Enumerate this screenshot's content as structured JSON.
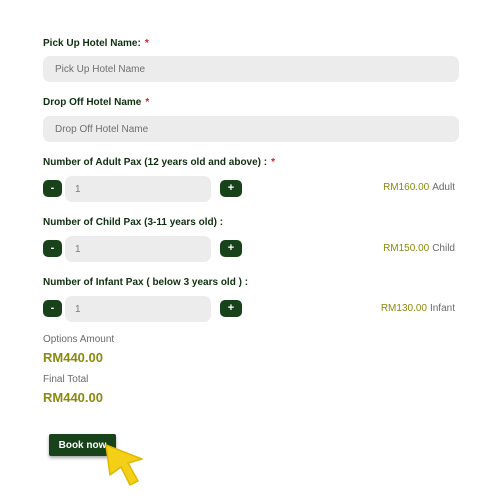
{
  "form": {
    "pickup": {
      "label": "Pick Up Hotel Name:",
      "required_mark": "*",
      "placeholder": "Pick Up Hotel Name",
      "value": ""
    },
    "dropoff": {
      "label": "Drop Off Hotel Name",
      "required_mark": "*",
      "placeholder": "Drop Off Hotel Name",
      "value": ""
    },
    "adult": {
      "label": "Number of Adult Pax (12 years old and above) :",
      "required_mark": "*",
      "minus": "-",
      "plus": "+",
      "value": "1",
      "price": "RM160.00",
      "unit": "Adult"
    },
    "child": {
      "label": "Number of Child Pax (3-11 years old) :",
      "minus": "-",
      "plus": "+",
      "value": "1",
      "price": "RM150.00",
      "unit": "Child"
    },
    "infant": {
      "label": "Number of Infant Pax ( below 3 years old ) :",
      "minus": "-",
      "plus": "+",
      "value": "1",
      "price": "RM130.00",
      "unit": "Infant"
    }
  },
  "summary": {
    "options_label": "Options Amount",
    "options_value": "RM440.00",
    "final_label": "Final Total",
    "final_value": "RM440.00"
  },
  "actions": {
    "book_label": "Book now"
  },
  "icons": {
    "cursor": "pointer-cursor-icon"
  },
  "colors": {
    "brand_green": "#17421a",
    "price_olive": "#8a8a0f",
    "required_red": "#d32027",
    "cursor_yellow": "#f3d017"
  }
}
